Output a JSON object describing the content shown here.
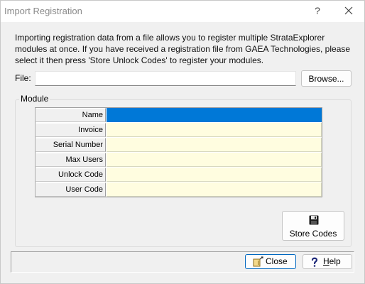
{
  "window": {
    "title": "Import Registration",
    "help_glyph": "?",
    "close_icon": "close-icon"
  },
  "intro": "Importing registration data from a file allows you to register multiple StrataExplorer modules at once. If you have received a registration file from GAEA Technologies, please select it then press 'Store Unlock Codes' to register your modules.",
  "file": {
    "label": "File:",
    "value": "",
    "browse_label": "Browse..."
  },
  "module": {
    "group_label": "Module",
    "rows": [
      {
        "label": "Name",
        "value": ""
      },
      {
        "label": "Invoice",
        "value": ""
      },
      {
        "label": "Serial Number",
        "value": ""
      },
      {
        "label": "Max Users",
        "value": ""
      },
      {
        "label": "Unlock Code",
        "value": ""
      },
      {
        "label": "User Code",
        "value": ""
      }
    ],
    "selected_row": 0,
    "selected_color": "#0078d7",
    "cell_color": "#fffde0"
  },
  "store": {
    "label": "Store Codes",
    "icon": "floppy-disk-icon"
  },
  "footer": {
    "close_label": "Close",
    "help_label": "Help",
    "help_underline": "H",
    "help_rest": "elp"
  }
}
